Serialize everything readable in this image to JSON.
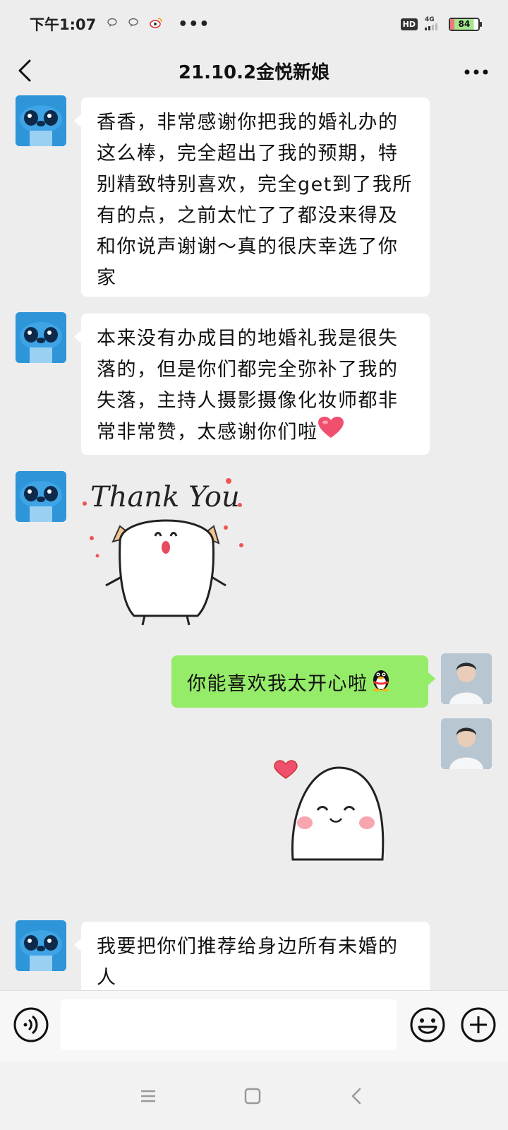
{
  "status_bar": {
    "time": "下午1:07",
    "notification_icons": [
      "chat-bubble-icon",
      "chat-bubble-icon",
      "weibo-icon"
    ],
    "more_dots": "•••",
    "hd_badge": "HD",
    "network": "4G",
    "battery": 84,
    "battery_label": "84"
  },
  "header": {
    "title": "21.10.2金悦新娘"
  },
  "messages": [
    {
      "side": "left",
      "type": "text",
      "text": "香香，非常感谢你把我的婚礼办的这么棒，完全超出了我的预期，特别精致特别喜欢，完全get到了我所有的点，之前太忙了了都没来得及和你说声谢谢～真的很庆幸选了你家"
    },
    {
      "side": "left",
      "type": "text",
      "text": "本来没有办成目的地婚礼我是很失落的，但是你们都完全弥补了我的失落，主持人摄影摄像化妆师都非常非常赞，太感谢你们啦",
      "emoji": "heart-emoji"
    },
    {
      "side": "left",
      "type": "sticker",
      "sticker": "thank-you-sticker",
      "sticker_text": "Thank You"
    },
    {
      "side": "right",
      "type": "text",
      "text": "你能喜欢我太开心啦",
      "emoji": "penguin-emoji"
    },
    {
      "side": "right",
      "type": "sticker",
      "sticker": "blushing-heart-sticker"
    },
    {
      "side": "left",
      "type": "text",
      "text": "我要把你们推荐给身边所有未婚的人"
    }
  ],
  "colors": {
    "background": "#ededed",
    "left_bubble": "#ffffff",
    "right_bubble": "#95ec69",
    "avatar_left": "#2f95d9"
  },
  "input_bar": {
    "placeholder": ""
  }
}
